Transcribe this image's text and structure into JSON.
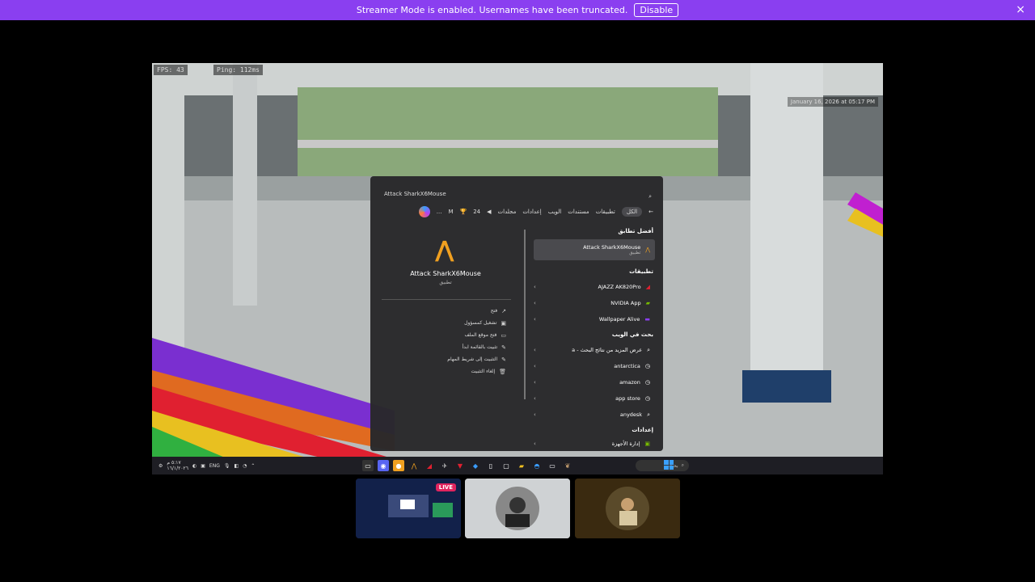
{
  "banner": {
    "message": "Streamer Mode is enabled. Usernames have been truncated.",
    "disable_label": "Disable",
    "close_icon": "×"
  },
  "hud": {
    "fps": "FPS: 43",
    "ping": "Ping: 112ms",
    "timestamp": "January 16, 2026 at 05:17 PM"
  },
  "start_menu": {
    "search_value": "Attack SharkX6Mouse",
    "tabs": [
      "الكل",
      "تطبيقات",
      "مستندات",
      "الويب",
      "إعدادات",
      "مجلدات"
    ],
    "tab_extras": [
      "24",
      "M",
      "..."
    ],
    "preview": {
      "name": "Attack SharkX6Mouse",
      "subtitle": "تطبيق"
    },
    "actions": [
      {
        "label": "فتح",
        "icon": "↗"
      },
      {
        "label": "تشغيل كمسؤول",
        "icon": "▣"
      },
      {
        "label": "فتح موقع الملف",
        "icon": "▭"
      },
      {
        "label": "تثبيت بالقائمة ابدأ",
        "icon": "✎"
      },
      {
        "label": "التثبيت إلى شريط المهام",
        "icon": "✎"
      },
      {
        "label": "إلغاء التثبيت",
        "icon": "🗑"
      }
    ],
    "best_match_title": "أفضل تطابق",
    "best_match": {
      "name": "Attack SharkX6Mouse",
      "subtitle": "تطبيق"
    },
    "apps_title": "تطبيقات",
    "apps": [
      "AJAZZ AK820Pro",
      "NVIDIA App",
      "Wallpaper Alive"
    ],
    "web_title": "بحث في الويب",
    "web_items": [
      "a - عرض المزيد من نتائج البحث",
      "antarctica",
      "amazon",
      "app store",
      "anydesk"
    ],
    "settings_title": "إعدادات",
    "settings_items": [
      "إدارة الأجهزة"
    ]
  },
  "taskbar": {
    "time": "٥:١٧ م",
    "date": "١٦/١/٢٠٢٦",
    "lang": "ENG",
    "search_placeholder": "بحث"
  },
  "thumbnails": {
    "live_badge": "LIVE"
  }
}
